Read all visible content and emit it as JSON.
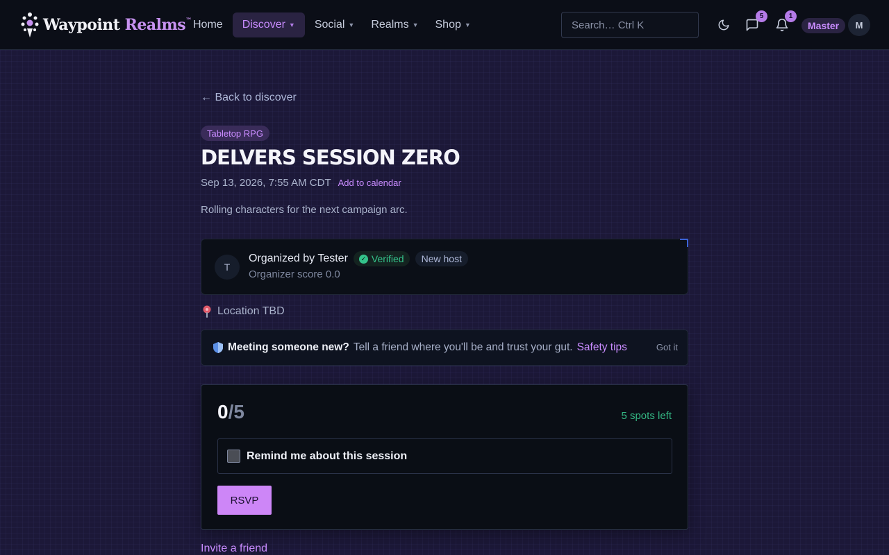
{
  "brand": {
    "name_part1": "Waypoint",
    "name_part2": "Realms",
    "trademark": "™"
  },
  "nav": {
    "home": "Home",
    "discover": "Discover",
    "social": "Social",
    "realms": "Realms",
    "shop": "Shop",
    "active": "Discover"
  },
  "search": {
    "placeholder": "Search…  Ctrl K"
  },
  "header": {
    "messages_count": "5",
    "notifications_count": "1",
    "user_role": "Master",
    "user_initial": "M"
  },
  "event": {
    "back_link": "← Back to discover",
    "category": "Tabletop RPG",
    "title": "DELVERS SESSION ZERO",
    "datetime": "Sep 13, 2026, 7:55 AM CDT",
    "add_calendar": "Add to calendar",
    "description": "Rolling characters for the next campaign arc."
  },
  "organizer": {
    "initial": "T",
    "label": "Organized by Tester",
    "verified": "Verified",
    "host_badge": "New host",
    "score": "Organizer score 0.0"
  },
  "location": {
    "text": "Location TBD"
  },
  "safety": {
    "headline": "Meeting someone new?",
    "body": "Tell a friend where you'll be and trust your gut.",
    "link": "Safety tips",
    "dismiss": "Got it"
  },
  "rsvp": {
    "taken": "0",
    "capacity": "/5",
    "spots_left": "5 spots left",
    "reminder_label": "Remind me about this session",
    "reminder_checked": false,
    "button": "RSVP"
  },
  "invite": {
    "link": "Invite a friend"
  },
  "colors": {
    "accent": "#c98cff",
    "success": "#34c38b",
    "background": "#1c1838",
    "topbar": "#0b0e17",
    "card": "#0a0e15"
  }
}
